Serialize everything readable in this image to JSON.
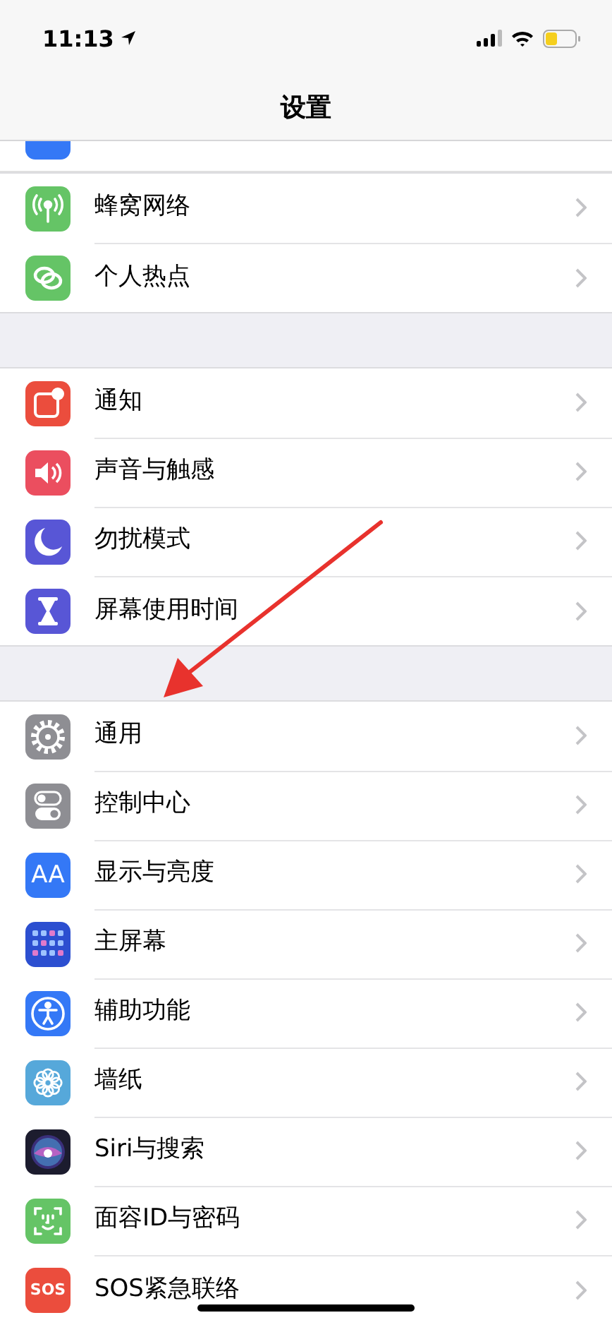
{
  "status_bar": {
    "time": "11:13"
  },
  "title": "设置",
  "groups": [
    {
      "items": [
        {
          "label": "蜂窝网络",
          "kind": "antenna",
          "color": "#65c466"
        },
        {
          "label": "个人热点",
          "kind": "links",
          "color": "#65c466"
        }
      ]
    },
    {
      "items": [
        {
          "label": "通知",
          "kind": "notification",
          "color": "#eb4d3d"
        },
        {
          "label": "声音与触感",
          "kind": "speaker",
          "color": "#eb4e5f"
        },
        {
          "label": "勿扰模式",
          "kind": "moon",
          "color": "#5856d6"
        },
        {
          "label": "屏幕使用时间",
          "kind": "hourglass",
          "color": "#5856d6"
        }
      ]
    },
    {
      "items": [
        {
          "label": "通用",
          "kind": "gear",
          "color": "#8e8e93"
        },
        {
          "label": "控制中心",
          "kind": "toggles",
          "color": "#8e8e93"
        },
        {
          "label": "显示与亮度",
          "kind": "text",
          "icon_text": "AA",
          "color": "#3478f6"
        },
        {
          "label": "主屏幕",
          "kind": "grid",
          "color": "#2c4fd0"
        },
        {
          "label": "辅助功能",
          "kind": "person",
          "color": "#3478f6"
        },
        {
          "label": "墙纸",
          "kind": "flower",
          "color": "#56a8da"
        },
        {
          "label": "Siri与搜索",
          "kind": "orb",
          "color": "#1c1c2e"
        },
        {
          "label": "面容ID与密码",
          "kind": "face",
          "color": "#65c466"
        },
        {
          "label": "SOS紧急联络",
          "kind": "text",
          "icon_text": "SOS",
          "color": "#eb4d3d"
        }
      ]
    }
  ]
}
